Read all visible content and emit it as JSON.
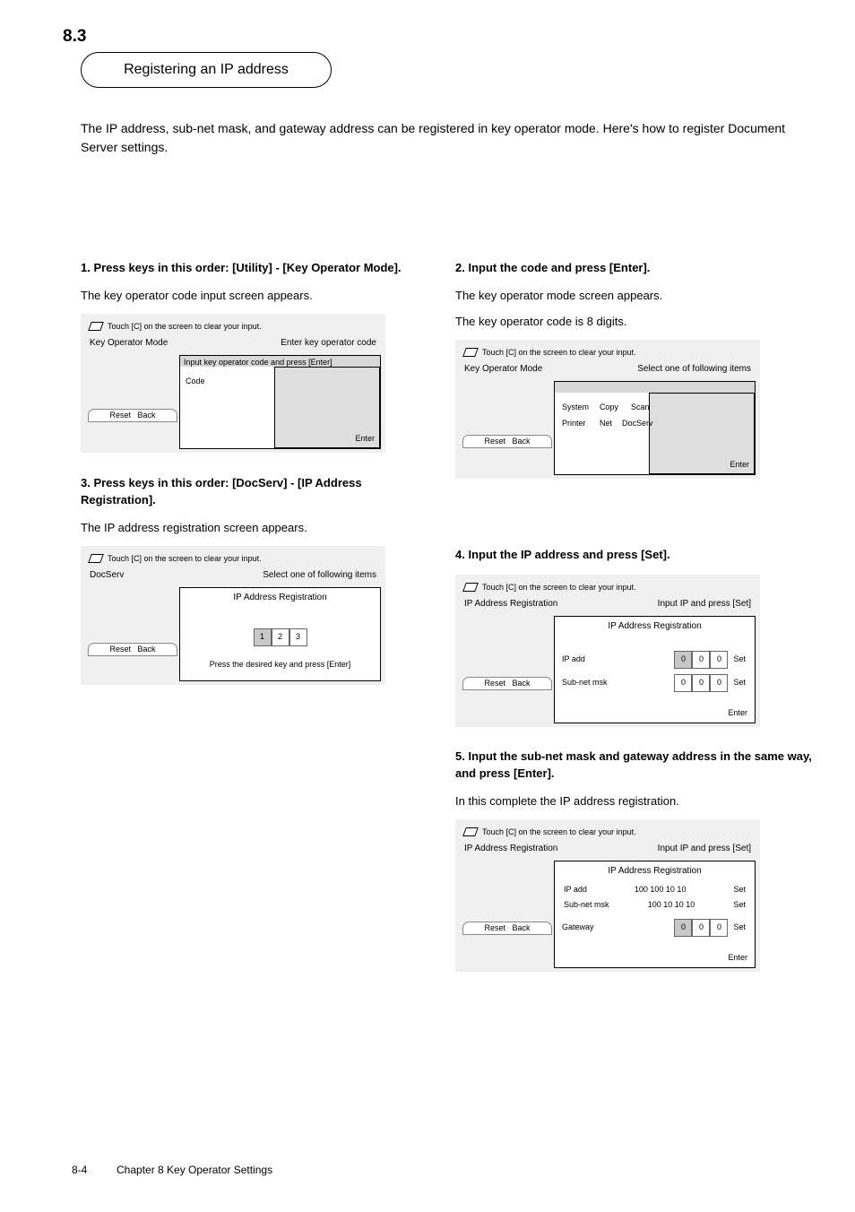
{
  "section_number": "8.3",
  "section_title": "Registering an IP address",
  "intro": "The IP address, sub-net mask, and gateway address can be registered in key operator mode. Here's how to register Document Server settings.",
  "steps": {
    "s1": {
      "heading": "1. Press keys in this order: [Utility] - [Key Operator Mode].",
      "desc": "The key operator code input screen appears.",
      "screen": {
        "clear_label": "Touch [C] on the screen to clear your input.",
        "mode_left": "Key Operator Mode",
        "mode_right": "Enter key operator code",
        "buttons": [
          "Reset",
          "Back"
        ],
        "popup_title": "Input key operator code and press [Enter]",
        "field_label": "Code",
        "enter": "Enter"
      }
    },
    "s2": {
      "heading": "2. Input the code and press [Enter].",
      "desc": "The key operator mode screen appears.",
      "note": "The key operator code is 8 digits.",
      "screen": {
        "clear_label": "Touch [C] on the screen to clear your input.",
        "mode_left": "Key Operator Mode",
        "mode_right": "Select one of following items",
        "buttons": [
          "Reset",
          "Back"
        ],
        "items": [
          "System",
          "Copy",
          "Scan"
        ],
        "items2": [
          "Printer",
          "Net",
          "DocServ"
        ],
        "enter": "Enter"
      }
    },
    "s3": {
      "heading": "3. Press keys in this order: [DocServ] - [IP Address Registration].",
      "desc": "The IP address registration screen appears.",
      "screen": {
        "clear_label": "Touch [C] on the screen to clear your input.",
        "mode_left": "DocServ",
        "mode_right": "Select one of following items",
        "buttons": [
          "Reset",
          "Back"
        ],
        "popup_title": "IP Address Registration",
        "btns": [
          "1",
          "2",
          "3"
        ],
        "submit": "Press the desired key and press [Enter]"
      }
    },
    "s4": {
      "heading": "4. Input the IP address and press [Set].",
      "screen": {
        "clear_label": "Touch [C] on the screen to clear your input.",
        "mode_left": "IP Address Registration",
        "mode_right": "Input IP and press [Set]",
        "buttons": [
          "Reset",
          "Back"
        ],
        "title": "IP Address Registration",
        "rows": [
          {
            "label": "IP add",
            "keys": [
              "0",
              "0",
              "0"
            ],
            "set": "Set"
          },
          {
            "label": "Sub-net msk",
            "keys": [
              "0",
              "0",
              "0"
            ],
            "set": "Set"
          }
        ],
        "enter": "Enter"
      }
    },
    "s5": {
      "heading": "5. Input the sub-net mask and gateway address in the same way, and press [Enter].",
      "desc": "In this complete the IP address registration.",
      "screen": {
        "clear_label": "Touch [C] on the screen to clear your input.",
        "mode_left": "IP Address Registration",
        "mode_right": "Input IP and press [Set]",
        "buttons": [
          "Reset",
          "Back"
        ],
        "title": "IP Address Registration",
        "rows": [
          {
            "label": "IP add",
            "value": "100 100 10 10",
            "set": "Set"
          },
          {
            "label": "Sub-net msk",
            "value": "100 10 10 10",
            "set": "Set"
          },
          {
            "label": "Gateway",
            "keys": [
              "0",
              "0",
              "0"
            ],
            "set": "Set"
          }
        ],
        "enter": "Enter"
      }
    }
  },
  "page_number": "8-4",
  "chapter_footer": "Chapter 8   Key Operator Settings"
}
